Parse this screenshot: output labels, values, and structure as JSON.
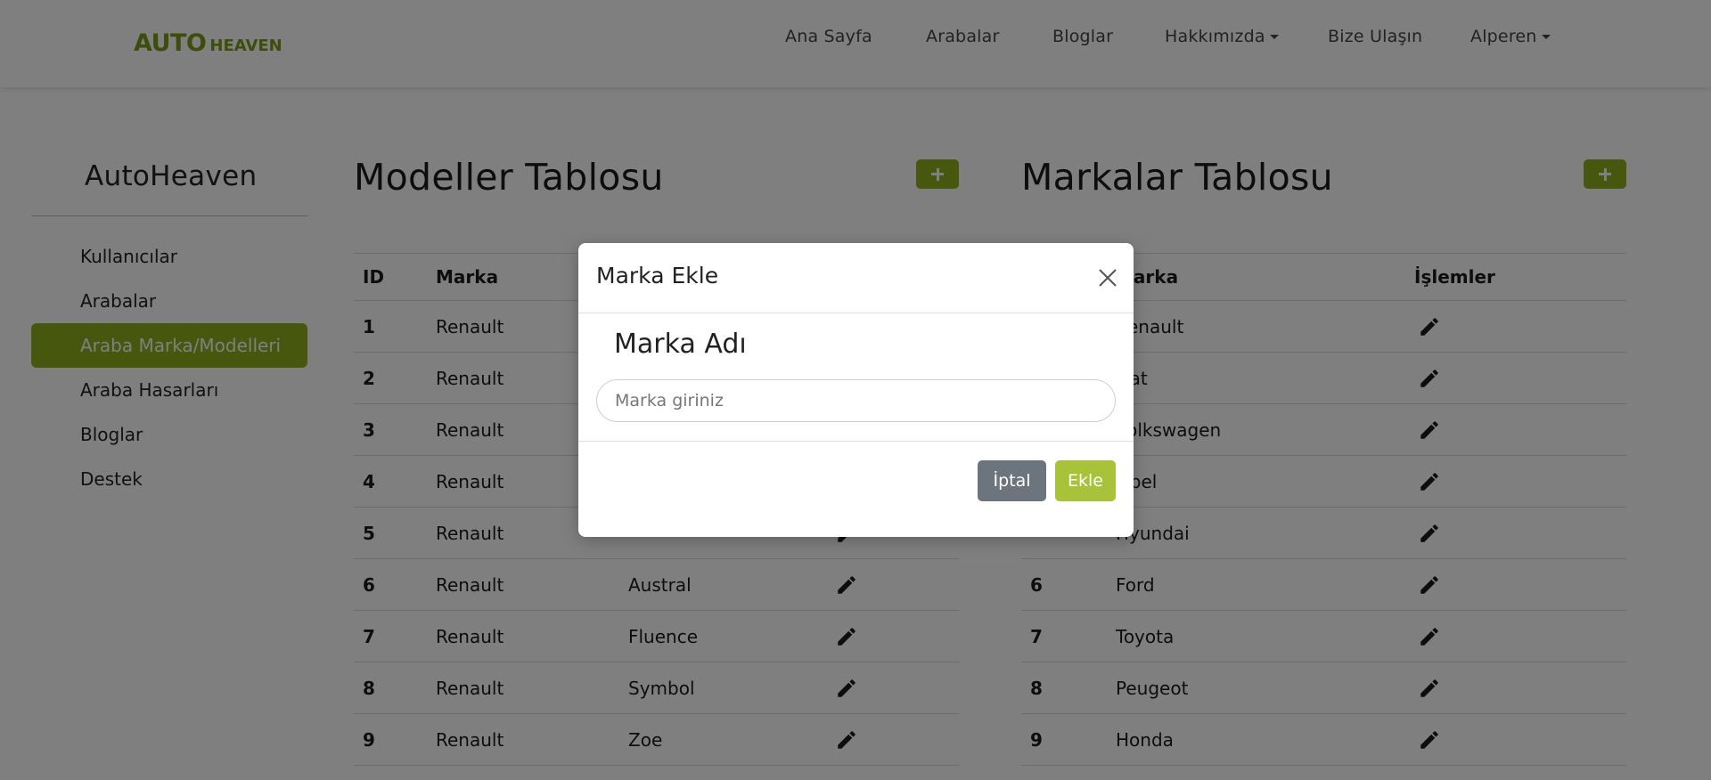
{
  "brand": {
    "logo_main": "AUTO",
    "logo_sub": "HEAVEN",
    "color": "#7a9a19"
  },
  "nav": {
    "home": "Ana Sayfa",
    "cars": "Arabalar",
    "blogs": "Bloglar",
    "about": "Hakkımızda",
    "contact": "Bize Ulaşın",
    "user": "Alperen"
  },
  "sidebar": {
    "title": "AutoHeaven",
    "items": [
      {
        "label": "Kullanıcılar"
      },
      {
        "label": "Arabalar"
      },
      {
        "label": "Araba Marka/Modelleri",
        "active": true
      },
      {
        "label": "Araba Hasarları"
      },
      {
        "label": "Bloglar"
      },
      {
        "label": "Destek"
      }
    ]
  },
  "models_table": {
    "title": "Modeller Tablosu",
    "headers": {
      "id": "ID",
      "brand": "Marka"
    },
    "rows": [
      {
        "id": "1",
        "brand": "Renault",
        "model": ""
      },
      {
        "id": "2",
        "brand": "Renault",
        "model": ""
      },
      {
        "id": "3",
        "brand": "Renault",
        "model": ""
      },
      {
        "id": "4",
        "brand": "Renault",
        "model": ""
      },
      {
        "id": "5",
        "brand": "Renault",
        "model": ""
      },
      {
        "id": "6",
        "brand": "Renault",
        "model": "Austral"
      },
      {
        "id": "7",
        "brand": "Renault",
        "model": "Fluence"
      },
      {
        "id": "8",
        "brand": "Renault",
        "model": "Symbol"
      },
      {
        "id": "9",
        "brand": "Renault",
        "model": "Zoe"
      }
    ]
  },
  "brands_table": {
    "title": "Markalar Tablosu",
    "headers": {
      "id": "",
      "brand": "Marka",
      "actions": "İşlemler"
    },
    "rows": [
      {
        "id": "",
        "brand": "Renault"
      },
      {
        "id": "",
        "brand": "Fiat"
      },
      {
        "id": "",
        "brand": "Volkswagen"
      },
      {
        "id": "",
        "brand": "Opel"
      },
      {
        "id": "",
        "brand": "Hyundai"
      },
      {
        "id": "6",
        "brand": "Ford"
      },
      {
        "id": "7",
        "brand": "Toyota"
      },
      {
        "id": "8",
        "brand": "Peugeot"
      },
      {
        "id": "9",
        "brand": "Honda"
      }
    ]
  },
  "modal": {
    "title": "Marka Ekle",
    "field_label": "Marka Adı",
    "input_placeholder": "Marka giriniz",
    "input_value": "",
    "cancel_label": "İptal",
    "add_label": "Ekle"
  },
  "colors": {
    "accent": "#8fae1b",
    "add_button": "#a8c33a",
    "cancel_button": "#6c757d",
    "backdrop": "rgba(0,0,0,0.5)"
  },
  "icons": {
    "add": "plus-icon",
    "edit": "pencil-icon",
    "close": "close-icon",
    "dropdown": "caret-down-icon"
  }
}
